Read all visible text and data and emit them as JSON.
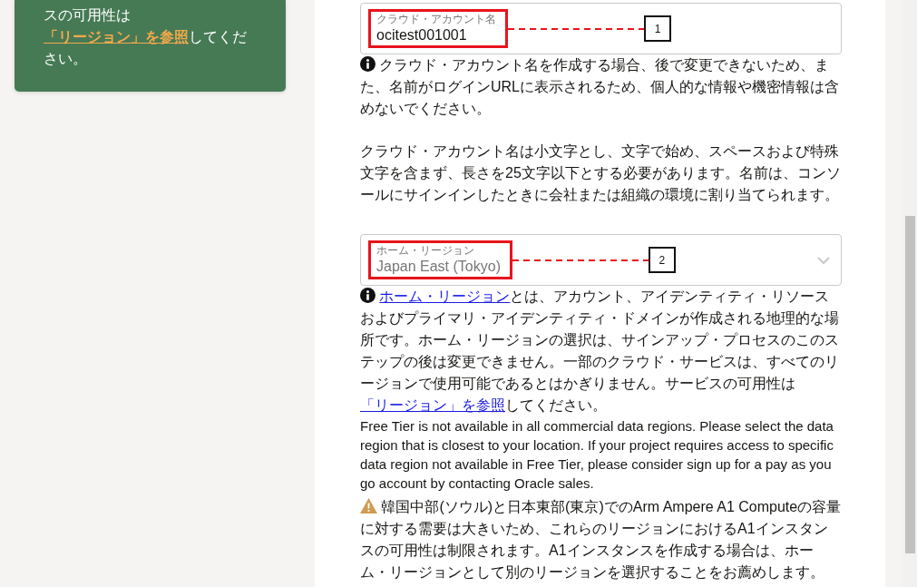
{
  "side_card": {
    "segments": [
      {
        "kind": "text",
        "text": "スの可用性は"
      },
      {
        "kind": "link",
        "text": "「リージョン」を参照"
      },
      {
        "kind": "text",
        "text": "してください。"
      }
    ]
  },
  "form": {
    "fields": [
      {
        "kind": "input",
        "label": "クラウド・アカウント名",
        "value": "ocitest001001",
        "callout": "1",
        "notes": [
          {
            "kind": "info",
            "segments": [
              {
                "kind": "text",
                "text": "クラウド・アカウント名を作成する場合、後で変更できないため、また、名前がログインURLに表示されるため、個人的な情報や機密情報は含めないでください。"
              }
            ]
          },
          {
            "kind": "plain",
            "segments": [
              {
                "kind": "text",
                "text": "クラウド・アカウント名は小文字とし、文字で始め、スペースおよび特殊文字を含まず、長さを25文字以下とする必要があります。名前は、コンソールにサインインしたときに会社または組織の環境に割り当てられます。"
              }
            ]
          }
        ]
      },
      {
        "kind": "select",
        "label": "ホーム・リージョン",
        "value": "Japan East (Tokyo)",
        "callout": "2",
        "notes": [
          {
            "kind": "info",
            "segments": [
              {
                "kind": "link",
                "text": "ホーム・リージョン"
              },
              {
                "kind": "text",
                "text": "とは、アカウント、アイデンティティ・リソースおよびプライマリ・アイデンティティ・ドメインが作成される地理的な場所です。ホーム・リージョンの選択は、サインアップ・プロセスのこのステップの後は変更できません。一部のクラウド・サービスは、すべてのリージョンで使用可能であるとはかぎりません。サービスの可用性は"
              },
              {
                "kind": "link",
                "text": "「リージョン」を参照"
              },
              {
                "kind": "text",
                "text": "してください。"
              }
            ]
          },
          {
            "kind": "small",
            "segments": [
              {
                "kind": "text",
                "text": "Free Tier is not available in all commercial data regions. Please select the data region that is closest to your location. If your project requires access to specific data region not available in Free Tier, please consider sign up for a pay as you go account by contacting Oracle sales."
              }
            ]
          },
          {
            "kind": "warning",
            "segments": [
              {
                "kind": "text",
                "text": "韓国中部(ソウル)と日本東部(東京)でのArm Ampere A1 Computeの容量に対する需要は大きいため、これらのリージョンにおけるA1インスタンスの可用性は制限されます。A1インスタンスを作成する場合は、ホーム・リージョンとして別のリージョンを選択することをお薦めします。"
              }
            ]
          }
        ]
      }
    ]
  }
}
